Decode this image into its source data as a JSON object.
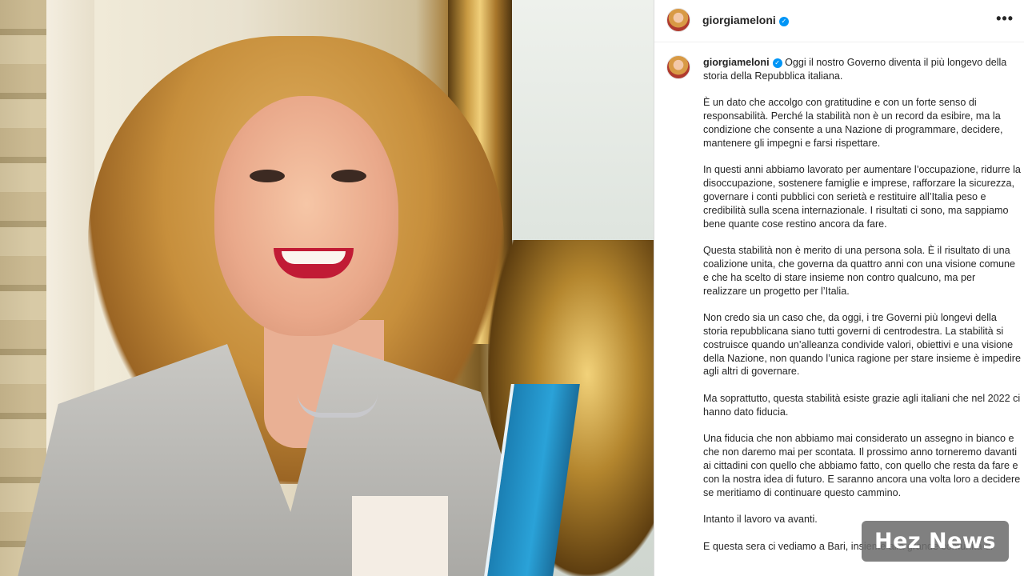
{
  "post": {
    "username": "giorgiameloni",
    "verified_icon": "verified-badge-icon",
    "more_icon": "•••",
    "caption_intro": "Oggi il nostro Governo diventa il più longevo della storia della Repubblica italiana.",
    "paragraphs": [
      "È un dato che accolgo con gratitudine e con un forte senso di responsabilità. Perché la stabilità non è un record da esibire, ma la condizione che consente a una Nazione di programmare, decidere, mantenere gli impegni e farsi rispettare.",
      "In questi anni abbiamo lavorato per aumentare l’occupazione, ridurre la disoccupazione, sostenere famiglie e imprese, rafforzare la sicurezza, governare i conti pubblici con serietà e restituire all’Italia peso e credibilità sulla scena internazionale. I risultati ci sono, ma sappiamo bene quante cose restino ancora da fare.",
      "Questa stabilità non è merito di una persona sola. È il risultato di una coalizione unita, che governa da quattro anni con una visione comune e che ha scelto di stare insieme non contro qualcuno, ma per realizzare un progetto per l’Italia.",
      "Non credo sia un caso che, da oggi, i tre Governi più longevi della storia repubblicana siano tutti governi di centrodestra. La stabilità si costruisce quando un’alleanza condivide valori, obiettivi e una visione della Nazione, non quando l’unica ragione per stare insieme è impedire agli altri di governare.",
      "Ma soprattutto, questa stabilità esiste grazie agli italiani che nel 2022 ci hanno dato fiducia.",
      "Una fiducia che non abbiamo mai considerato un assegno in bianco e che non daremo mai per scontata. Il prossimo anno torneremo davanti ai cittadini con quello che abbiamo fatto, con quello che resta da fare e con la nostra idea di futuro. E saranno ancora una volta loro a decidere se meritiamo di continuare questo cammino.",
      "Intanto il lavoro va avanti.",
      "E questa sera ci vediamo a Bari, insieme alla grande comunità di"
    ]
  },
  "watermark": "Hez News",
  "colors": {
    "verified": "#0095f6",
    "text": "#262626",
    "watermark_bg": "#6e6e6e"
  }
}
